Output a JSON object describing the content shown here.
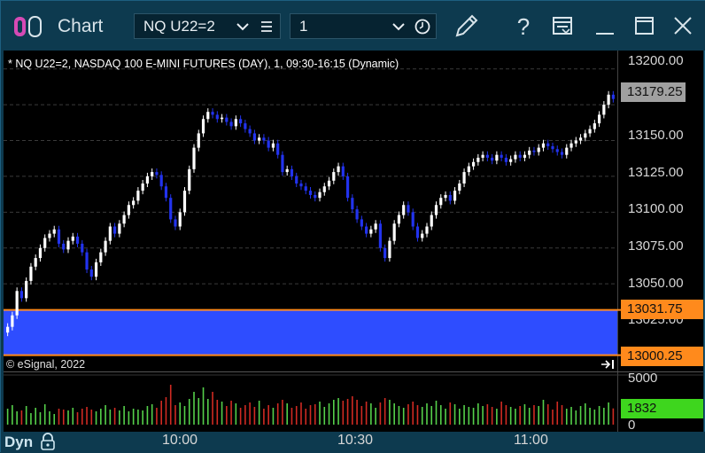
{
  "window": {
    "title": "Chart",
    "symbol_value": "NQ U22=2",
    "interval_value": "1"
  },
  "chart_info": {
    "header": "* NQ U22=2, NASDAQ 100 E-MINI FUTURES (DAY), 1, 09:30-16:15 (Dynamic)",
    "copyright": "© eSignal, 2022"
  },
  "price_axis": {
    "labels": [
      "13200.00",
      "13175.00",
      "13150.00",
      "13125.00",
      "13100.00",
      "13075.00",
      "13050.00",
      "13025.00"
    ],
    "last_price": "13179.25",
    "band_high": "13031.75",
    "band_low": "13000.25"
  },
  "volume_axis": {
    "max_label": "5000",
    "zero_label": "0",
    "current": "1832"
  },
  "time_axis": {
    "labels": [
      "10:00",
      "10:30",
      "11:00"
    ]
  },
  "status": {
    "mode": "Dyn"
  },
  "colors": {
    "up": "#ffffff",
    "down": "#2233ee",
    "band": "#2e4dff",
    "band_edge": "#ff8a1c",
    "vol_up": "#55d04a",
    "vol_down": "#d02a22",
    "last_price_bg": "#a0a0a0",
    "volume_tag_bg": "#3ed61e"
  },
  "chart_data": {
    "type": "candlestick",
    "ylim": [
      13000,
      13206
    ],
    "grid": true,
    "closes": [
      13020,
      13028,
      13045,
      13040,
      13052,
      13062,
      13068,
      13075,
      13082,
      13085,
      13088,
      13078,
      13074,
      13080,
      13083,
      13078,
      13072,
      13060,
      13055,
      13065,
      13072,
      13080,
      13090,
      13085,
      13092,
      13098,
      13105,
      13108,
      13115,
      13120,
      13125,
      13128,
      13126,
      13118,
      13110,
      13095,
      13090,
      13100,
      13115,
      13130,
      13145,
      13155,
      13165,
      13170,
      13168,
      13165,
      13166,
      13163,
      13160,
      13165,
      13162,
      13158,
      13155,
      13150,
      13152,
      13150,
      13145,
      13148,
      13140,
      13128,
      13130,
      13125,
      13120,
      13118,
      13115,
      13112,
      13110,
      13114,
      13118,
      13122,
      13128,
      13132,
      13125,
      13110,
      13102,
      13095,
      13090,
      13085,
      13088,
      13092,
      13075,
      13068,
      13080,
      13092,
      13098,
      13105,
      13100,
      13090,
      13082,
      13085,
      13090,
      13098,
      13105,
      13110,
      13112,
      13108,
      13115,
      13120,
      13128,
      13132,
      13135,
      13138,
      13140,
      13138,
      13136,
      13140,
      13138,
      13135,
      13137,
      13140,
      13138,
      13140,
      13143,
      13142,
      13145,
      13148,
      13146,
      13144,
      13142,
      13140,
      13145,
      13148,
      13150,
      13152,
      13155,
      13158,
      13162,
      13168,
      13175,
      13182,
      13179
    ],
    "volumes": [
      1800,
      2200,
      1500,
      1600,
      2100,
      1300,
      1900,
      1400,
      2300,
      1500,
      1200,
      1800,
      1700,
      1600,
      1900,
      1400,
      1800,
      2000,
      1700,
      1500,
      1800,
      2200,
      1700,
      1900,
      1600,
      2100,
      1500,
      1800,
      1700,
      1600,
      2100,
      2300,
      1900,
      2700,
      3100,
      4500,
      2200,
      2500,
      2100,
      2900,
      3700,
      3000,
      4200,
      2900,
      3700,
      2800,
      2600,
      2100,
      2700,
      2400,
      1900,
      2200,
      2500,
      2000,
      2700,
      1800,
      2200,
      1900,
      2400,
      2800,
      2400,
      1900,
      2100,
      2500,
      1800,
      2200,
      2300,
      2600,
      2000,
      2400,
      2800,
      3000,
      2700,
      2900,
      3200,
      2800,
      2100,
      2600,
      2400,
      1900,
      2500,
      3000,
      2800,
      2400,
      2100,
      1900,
      2300,
      2600,
      2200,
      2000,
      2400,
      2100,
      2700,
      2200,
      1800,
      2500,
      2300,
      1800,
      2200,
      2000,
      1900,
      2400,
      2100,
      2300,
      2000,
      1800,
      2600,
      2200,
      2000,
      1800,
      2100,
      2300,
      1900,
      2200,
      2100,
      2800,
      2300,
      1700,
      2600,
      2200,
      1800,
      2000,
      1600,
      2100,
      2400,
      1900,
      1700,
      2100,
      1900,
      2500,
      1832
    ]
  }
}
